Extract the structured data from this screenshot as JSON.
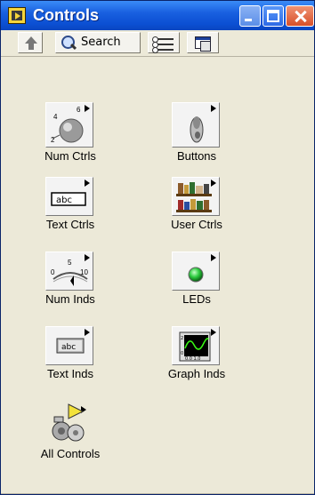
{
  "window": {
    "title": "Controls"
  },
  "titlebar": {
    "minimize_icon": "minimize-icon",
    "maximize_icon": "maximize-icon",
    "close_icon": "close-icon"
  },
  "toolbar": {
    "up_icon": "up-arrow-icon",
    "search_label": "Search",
    "view_icon": "view-options-icon",
    "window_icon": "window-icon"
  },
  "palette": {
    "items": [
      {
        "label": "Num Ctrls",
        "icon": "knob-icon"
      },
      {
        "label": "Buttons",
        "icon": "toggle-switch-icon"
      },
      {
        "label": "Text Ctrls",
        "icon": "text-box-icon"
      },
      {
        "label": "User Ctrls",
        "icon": "bookshelf-icon"
      },
      {
        "label": "Num Inds",
        "icon": "meter-icon"
      },
      {
        "label": "LEDs",
        "icon": "led-icon"
      },
      {
        "label": "Text Inds",
        "icon": "text-indicator-icon"
      },
      {
        "label": "Graph Inds",
        "icon": "graph-icon"
      },
      {
        "label": "All Controls",
        "icon": "all-controls-icon"
      }
    ]
  },
  "colors": {
    "titlebar": "#0b4fd2",
    "panel": "#ece9d8",
    "led_green": "#2ecc40",
    "graph_bg": "#000000",
    "graph_trace": "#39ff14"
  }
}
